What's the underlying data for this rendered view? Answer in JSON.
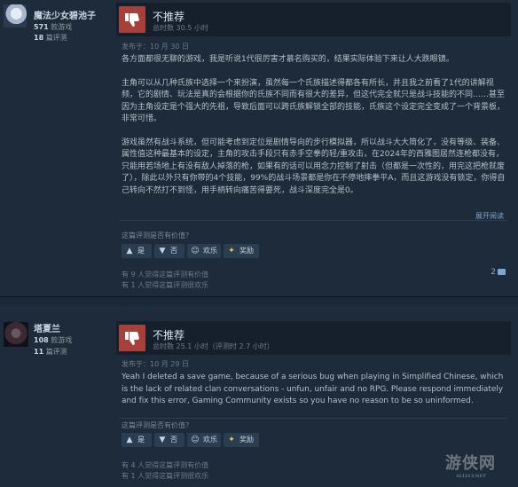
{
  "reviews": [
    {
      "author": {
        "name": "魔法少女碧池子",
        "games_owned": "571",
        "games_label": "款游戏",
        "reviews_count": "18",
        "reviews_label": "篇评测"
      },
      "verdict": "不推荐",
      "hours": "总时数 30.5 小时",
      "posted": "发布于：10 月 30 日",
      "paragraphs": [
        "各方面都很无聊的游戏，我是听说1代很厉害才慕名购买的，结果实际体验下来让人大跌眼镜。",
        "主角可以从几种氏族中选择一个来扮演，虽然每一个氏族描述得都各有所长，并且我之前看了1代的讲解视频，它的剧情、玩法是真的会根据你的氏族不同而有很大的差异，但这代完全就只是战斗技能的不同……甚至因为主角设定是个强大的先祖，导致后面可以跨氏族解锁全部的技能，氏族这个设定完全变成了一个背景板，非常可惜。",
        "游戏虽然有战斗系统，但可能考虑到定位是剧情导向的步行模拟器，所以战斗大大简化了，没有等级、装备、属性值这种最基本的设定，主角的攻击手段只有赤手空拳的轻/重攻击，在2024年的西雅图居然连枪都没有，只能用若场地上有没有敌人掉落的枪，如果有的话可以用念力控制了射击（但都是一次性的，用完这把枪就废了），除此以外只有你带的4个技能，99%的战斗场景都是你在不停地摔拳平A，而且这游戏没有锁定，你得自己转向不然打不到怪，用手柄转向痛苦得要死，战斗深度完全是0。"
      ],
      "expand_label": "展开阅读",
      "helpful_question": "这篇评测是否有价值？",
      "buttons": {
        "yes": "是",
        "no": "否",
        "funny": "欢乐",
        "award": "奖励"
      },
      "comments_count": "2",
      "helpful_count": "有 9 人觉得这篇评测有价值",
      "funny_count": "有 1 人觉得这篇评测很欢乐"
    },
    {
      "author": {
        "name": "塔夏兰",
        "games_owned": "108",
        "games_label": "款游戏",
        "reviews_count": "11",
        "reviews_label": "篇评测"
      },
      "verdict": "不推荐",
      "hours": "总时数 25.1 小时（评测时 2.7 小时）",
      "posted": "发布于：10 月 29 日",
      "paragraphs": [
        "Yeah I deleted a save game, because of a serious bug when playing in Simplified Chinese, which is the lack of related clan conversations - unfun, unfair and no RPG. Please respond immediately and fix this error, Gaming Community exists so you have no reason to be so uninformed."
      ],
      "helpful_question": "这篇评测是否有价值？",
      "buttons": {
        "yes": "是",
        "no": "否",
        "funny": "欢乐",
        "award": "奖励"
      },
      "helpful_count": "有 4 人觉得这篇评测有价值",
      "funny_count": "有 1 人觉得这篇评测很欢乐"
    }
  ],
  "watermark": {
    "text": "游侠网",
    "sub": "ALI213.NET"
  },
  "icons": {
    "thumb_down": "thumbs-down-icon",
    "thumb_up_small": "thumbs-up-icon",
    "thumb_down_small": "thumbs-down-icon",
    "funny": "smiley-icon",
    "award": "award-icon",
    "comment": "comment-bubble-icon"
  },
  "colors": {
    "background": "#1b2838",
    "thumb_red": "#a7403a",
    "link": "#7ea7cf"
  }
}
